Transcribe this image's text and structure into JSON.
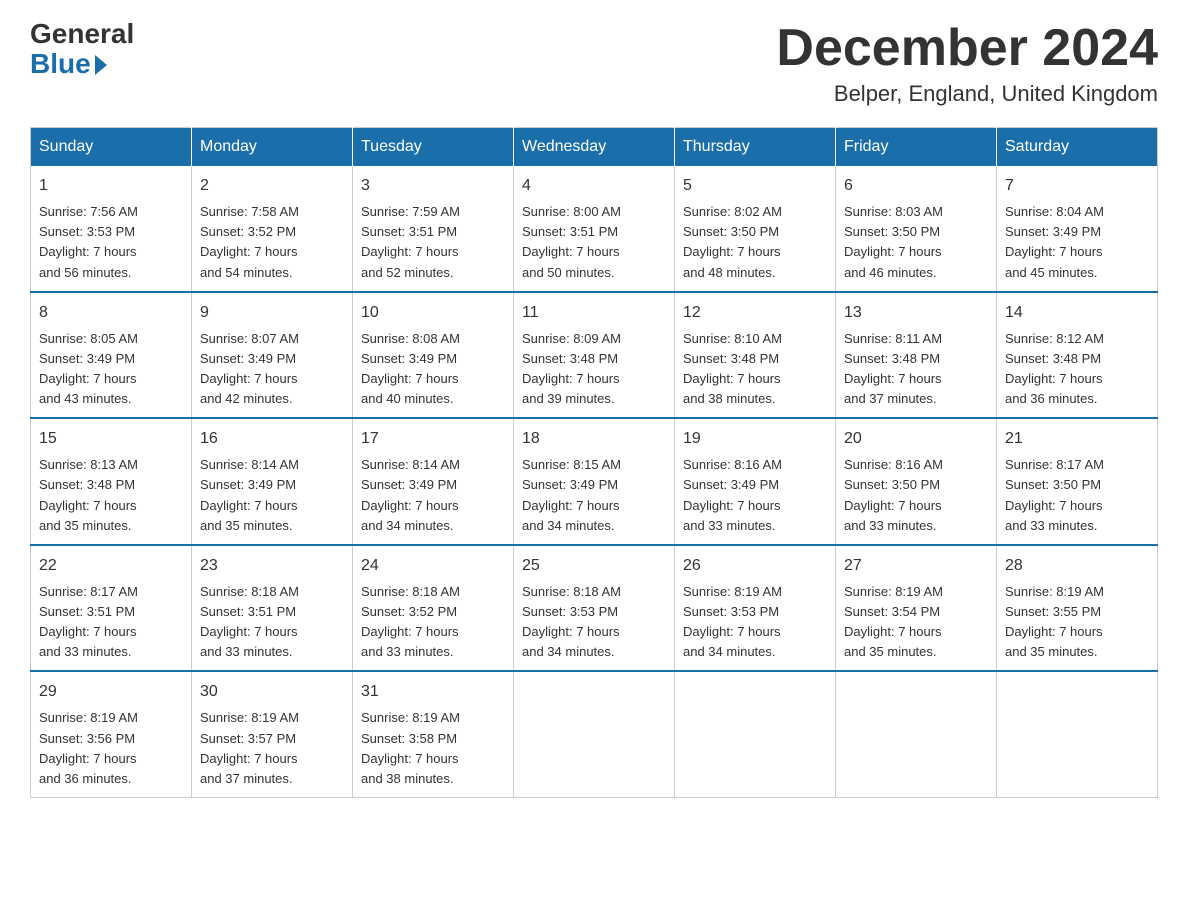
{
  "logo": {
    "general": "General",
    "blue": "Blue"
  },
  "title": "December 2024",
  "location": "Belper, England, United Kingdom",
  "days_of_week": [
    "Sunday",
    "Monday",
    "Tuesday",
    "Wednesday",
    "Thursday",
    "Friday",
    "Saturday"
  ],
  "weeks": [
    [
      {
        "day": "1",
        "info": "Sunrise: 7:56 AM\nSunset: 3:53 PM\nDaylight: 7 hours\nand 56 minutes."
      },
      {
        "day": "2",
        "info": "Sunrise: 7:58 AM\nSunset: 3:52 PM\nDaylight: 7 hours\nand 54 minutes."
      },
      {
        "day": "3",
        "info": "Sunrise: 7:59 AM\nSunset: 3:51 PM\nDaylight: 7 hours\nand 52 minutes."
      },
      {
        "day": "4",
        "info": "Sunrise: 8:00 AM\nSunset: 3:51 PM\nDaylight: 7 hours\nand 50 minutes."
      },
      {
        "day": "5",
        "info": "Sunrise: 8:02 AM\nSunset: 3:50 PM\nDaylight: 7 hours\nand 48 minutes."
      },
      {
        "day": "6",
        "info": "Sunrise: 8:03 AM\nSunset: 3:50 PM\nDaylight: 7 hours\nand 46 minutes."
      },
      {
        "day": "7",
        "info": "Sunrise: 8:04 AM\nSunset: 3:49 PM\nDaylight: 7 hours\nand 45 minutes."
      }
    ],
    [
      {
        "day": "8",
        "info": "Sunrise: 8:05 AM\nSunset: 3:49 PM\nDaylight: 7 hours\nand 43 minutes."
      },
      {
        "day": "9",
        "info": "Sunrise: 8:07 AM\nSunset: 3:49 PM\nDaylight: 7 hours\nand 42 minutes."
      },
      {
        "day": "10",
        "info": "Sunrise: 8:08 AM\nSunset: 3:49 PM\nDaylight: 7 hours\nand 40 minutes."
      },
      {
        "day": "11",
        "info": "Sunrise: 8:09 AM\nSunset: 3:48 PM\nDaylight: 7 hours\nand 39 minutes."
      },
      {
        "day": "12",
        "info": "Sunrise: 8:10 AM\nSunset: 3:48 PM\nDaylight: 7 hours\nand 38 minutes."
      },
      {
        "day": "13",
        "info": "Sunrise: 8:11 AM\nSunset: 3:48 PM\nDaylight: 7 hours\nand 37 minutes."
      },
      {
        "day": "14",
        "info": "Sunrise: 8:12 AM\nSunset: 3:48 PM\nDaylight: 7 hours\nand 36 minutes."
      }
    ],
    [
      {
        "day": "15",
        "info": "Sunrise: 8:13 AM\nSunset: 3:48 PM\nDaylight: 7 hours\nand 35 minutes."
      },
      {
        "day": "16",
        "info": "Sunrise: 8:14 AM\nSunset: 3:49 PM\nDaylight: 7 hours\nand 35 minutes."
      },
      {
        "day": "17",
        "info": "Sunrise: 8:14 AM\nSunset: 3:49 PM\nDaylight: 7 hours\nand 34 minutes."
      },
      {
        "day": "18",
        "info": "Sunrise: 8:15 AM\nSunset: 3:49 PM\nDaylight: 7 hours\nand 34 minutes."
      },
      {
        "day": "19",
        "info": "Sunrise: 8:16 AM\nSunset: 3:49 PM\nDaylight: 7 hours\nand 33 minutes."
      },
      {
        "day": "20",
        "info": "Sunrise: 8:16 AM\nSunset: 3:50 PM\nDaylight: 7 hours\nand 33 minutes."
      },
      {
        "day": "21",
        "info": "Sunrise: 8:17 AM\nSunset: 3:50 PM\nDaylight: 7 hours\nand 33 minutes."
      }
    ],
    [
      {
        "day": "22",
        "info": "Sunrise: 8:17 AM\nSunset: 3:51 PM\nDaylight: 7 hours\nand 33 minutes."
      },
      {
        "day": "23",
        "info": "Sunrise: 8:18 AM\nSunset: 3:51 PM\nDaylight: 7 hours\nand 33 minutes."
      },
      {
        "day": "24",
        "info": "Sunrise: 8:18 AM\nSunset: 3:52 PM\nDaylight: 7 hours\nand 33 minutes."
      },
      {
        "day": "25",
        "info": "Sunrise: 8:18 AM\nSunset: 3:53 PM\nDaylight: 7 hours\nand 34 minutes."
      },
      {
        "day": "26",
        "info": "Sunrise: 8:19 AM\nSunset: 3:53 PM\nDaylight: 7 hours\nand 34 minutes."
      },
      {
        "day": "27",
        "info": "Sunrise: 8:19 AM\nSunset: 3:54 PM\nDaylight: 7 hours\nand 35 minutes."
      },
      {
        "day": "28",
        "info": "Sunrise: 8:19 AM\nSunset: 3:55 PM\nDaylight: 7 hours\nand 35 minutes."
      }
    ],
    [
      {
        "day": "29",
        "info": "Sunrise: 8:19 AM\nSunset: 3:56 PM\nDaylight: 7 hours\nand 36 minutes."
      },
      {
        "day": "30",
        "info": "Sunrise: 8:19 AM\nSunset: 3:57 PM\nDaylight: 7 hours\nand 37 minutes."
      },
      {
        "day": "31",
        "info": "Sunrise: 8:19 AM\nSunset: 3:58 PM\nDaylight: 7 hours\nand 38 minutes."
      },
      {
        "day": "",
        "info": ""
      },
      {
        "day": "",
        "info": ""
      },
      {
        "day": "",
        "info": ""
      },
      {
        "day": "",
        "info": ""
      }
    ]
  ]
}
